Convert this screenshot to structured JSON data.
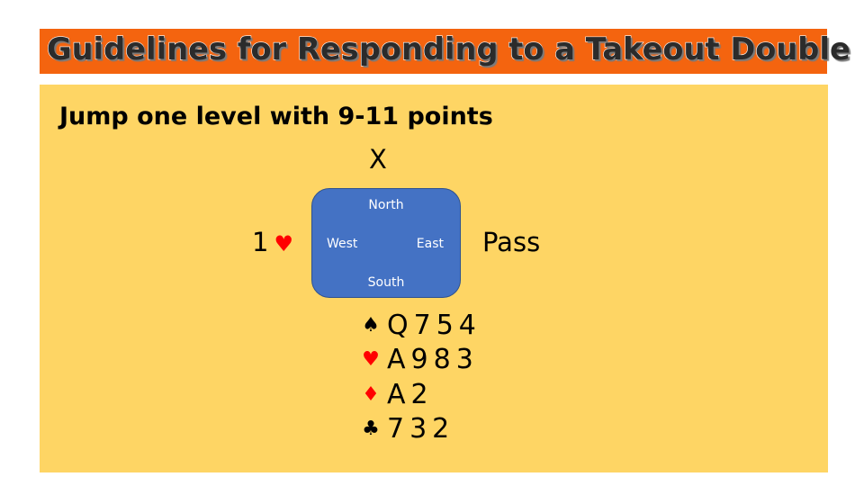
{
  "slide": {
    "title": "Guidelines for Responding to a Takeout Double",
    "subtitle": "Jump one level with 9-11 points",
    "colors": {
      "title_bar": "#f4640f",
      "panel": "#fed564",
      "table": "#4472c4",
      "red_suit": "#ff0000"
    }
  },
  "auction": {
    "north_call": "X",
    "west_call_level": "1",
    "west_call_suit": "♥",
    "east_call": "Pass"
  },
  "table": {
    "north": "North",
    "south": "South",
    "west": "West",
    "east": "East"
  },
  "hand": [
    {
      "suit_icon": "spade-icon",
      "symbol": "♠",
      "cards": "Q754",
      "color": "black"
    },
    {
      "suit_icon": "heart-icon",
      "symbol": "♥",
      "cards": "A983",
      "color": "red"
    },
    {
      "suit_icon": "diamond-icon",
      "symbol": "♦",
      "cards": "A2",
      "color": "red"
    },
    {
      "suit_icon": "club-icon",
      "symbol": "♣",
      "cards": "732",
      "color": "black"
    }
  ]
}
